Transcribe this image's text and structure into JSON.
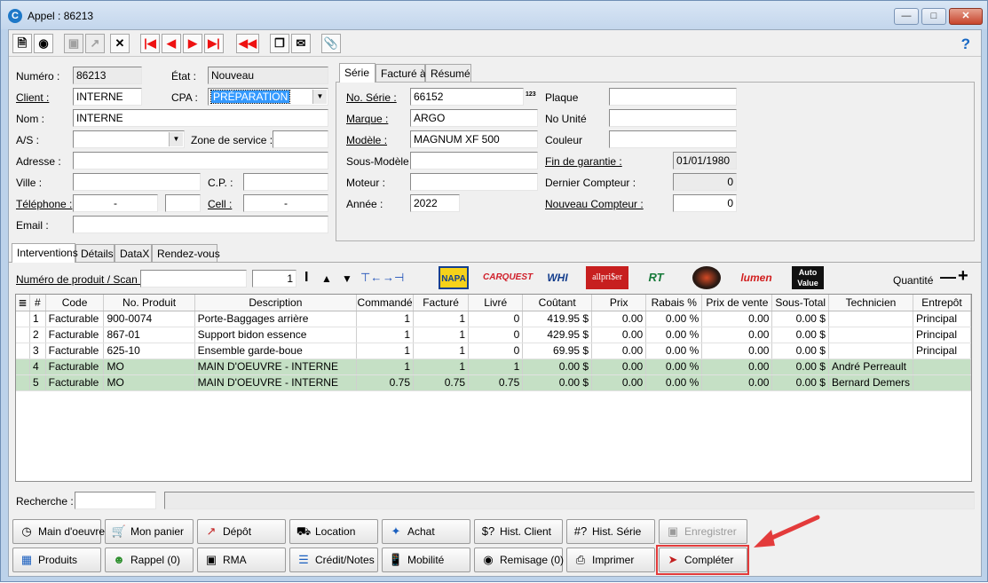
{
  "window": {
    "title": "Appel : 86213"
  },
  "toolbar": {
    "help": "?"
  },
  "form": {
    "numero_label": "Numéro :",
    "numero": "86213",
    "etat_label": "État :",
    "etat": "Nouveau",
    "client_label": "Client :",
    "client": "INTERNE",
    "cpa_label": "CPA :",
    "cpa": "PRÉPARATION",
    "nom_label": "Nom :",
    "nom": "INTERNE",
    "as_label": "A/S :",
    "zone_label": "Zone de service :",
    "adresse_label": "Adresse :",
    "ville_label": "Ville :",
    "cp_label": "C.P. :",
    "tel_label": "Téléphone :",
    "tel": "-",
    "cell_label": "Cell :",
    "cell": "-",
    "email_label": "Email :"
  },
  "serie_tabs": [
    "Série",
    "Facturé à",
    "Résumé"
  ],
  "serie": {
    "no_serie_label": "No. Série :",
    "no_serie": "66152",
    "no_serie_badge": "123",
    "marque_label": "Marque :",
    "marque": "ARGO",
    "modele_label": "Modèle :",
    "modele": "MAGNUM XF 500",
    "sous_modele_label": "Sous-Modèle :",
    "moteur_label": "Moteur :",
    "annee_label": "Année :",
    "annee": "2022",
    "plaque_label": "Plaque",
    "no_unite_label": "No Unité",
    "couleur_label": "Couleur",
    "fin_garantie_label": "Fin de garantie :",
    "fin_garantie": "01/01/1980",
    "dernier_compteur_label": "Dernier Compteur :",
    "dernier_compteur": "0",
    "nouveau_compteur_label": "Nouveau Compteur :",
    "nouveau_compteur": "0"
  },
  "lower_tabs": [
    "Interventions",
    "Détails",
    "DataX",
    "Rendez-vous"
  ],
  "scan": {
    "label": "Numéro de produit / Scan :",
    "qty": "1",
    "quantite_label": "Quantité"
  },
  "brands": [
    "NAPA",
    "CARQUEST",
    "WHI",
    "allpri$er",
    "RT",
    "",
    "lumen",
    "Auto Value"
  ],
  "grid": {
    "headers": [
      "",
      "#",
      "Code",
      "No. Produit",
      "Description",
      "Commandé",
      "Facturé",
      "Livré",
      "Coûtant",
      "Prix",
      "Rabais %",
      "Prix de vente",
      "Sous-Total",
      "Technicien",
      "Entrepôt"
    ],
    "rows": [
      [
        "",
        "1",
        "Facturable",
        "900-0074",
        "Porte-Baggages arrière",
        "1",
        "1",
        "0",
        "419.95 $",
        "0.00",
        "0.00 %",
        "0.00",
        "0.00 $",
        "",
        "Principal"
      ],
      [
        "",
        "2",
        "Facturable",
        "867-01",
        "Support bidon essence",
        "1",
        "1",
        "0",
        "429.95 $",
        "0.00",
        "0.00 %",
        "0.00",
        "0.00 $",
        "",
        "Principal"
      ],
      [
        "",
        "3",
        "Facturable",
        "625-10",
        "Ensemble garde-boue",
        "1",
        "1",
        "0",
        "69.95 $",
        "0.00",
        "0.00 %",
        "0.00",
        "0.00 $",
        "",
        "Principal"
      ],
      [
        "",
        "4",
        "Facturable",
        "MO",
        "MAIN D'OEUVRE - INTERNE",
        "1",
        "1",
        "1",
        "0.00 $",
        "0.00",
        "0.00 %",
        "0.00",
        "0.00 $",
        "André Perreault",
        ""
      ],
      [
        "",
        "5",
        "Facturable",
        "MO",
        "MAIN D'OEUVRE - INTERNE",
        "0.75",
        "0.75",
        "0.75",
        "0.00 $",
        "0.00",
        "0.00 %",
        "0.00",
        "0.00 $",
        "Bernard Demers",
        ""
      ]
    ]
  },
  "search": {
    "label": "Recherche :"
  },
  "buttons": {
    "main_oeuvre": "Main d'oeuvre",
    "mon_panier": "Mon panier",
    "depot": "Dépôt",
    "location": "Location",
    "achat": "Achat",
    "hist_client": "Hist. Client",
    "hist_serie": "Hist. Série",
    "enregistrer": "Enregistrer",
    "produits": "Produits",
    "rappel": "Rappel (0)",
    "rma": "RMA",
    "credit_notes": "Crédit/Notes",
    "mobilite": "Mobilité",
    "remisage": "Remisage (0)",
    "imprimer": "Imprimer",
    "completer": "Compléter"
  },
  "colors": {
    "accent": "#3399ff",
    "row_green": "#c5e0c5",
    "annotation": "#e33b3b"
  }
}
